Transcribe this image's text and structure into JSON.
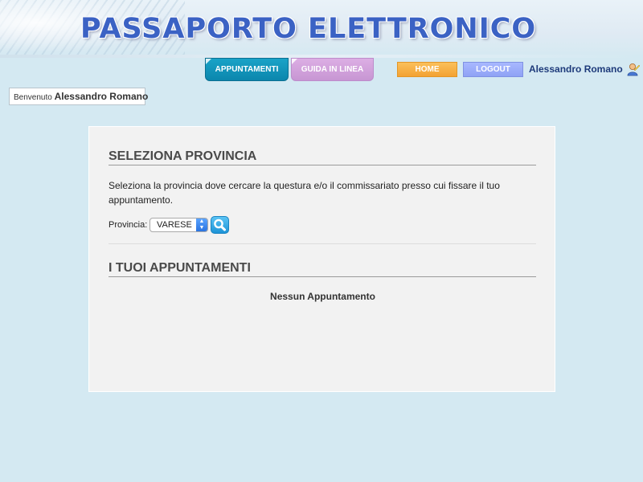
{
  "header": {
    "title": "PASSAPORTO ELETTRONICO",
    "user_name": "Alessandro Romano"
  },
  "nav": {
    "tabs": [
      {
        "label": "APPUNTAMENTI",
        "active": true
      },
      {
        "label": "GUIDA IN LINEA",
        "active": false
      }
    ],
    "home_label": "HOME",
    "logout_label": "LOGOUT"
  },
  "welcome": {
    "prefix": "Benvenuto",
    "name": "Alessandro Romano"
  },
  "provincia_section": {
    "title": "SELEZIONA PROVINCIA",
    "description": "Seleziona la provincia dove cercare la questura e/o il commissariato presso cui fissare il tuo appuntamento.",
    "label": "Provincia:",
    "selected": "VARESE"
  },
  "appuntamenti_section": {
    "title": "I TUOI APPUNTAMENTI",
    "empty_message": "Nessun Appuntamento"
  },
  "colors": {
    "background": "#d4e9f2",
    "active_tab": "#0b86ad",
    "guide_tab": "#c796d3",
    "home_button": "#f3a233",
    "logout_button": "#8fa2f5",
    "title_blue": "#3b62c4"
  },
  "icons": [
    "user-icon",
    "search-icon",
    "select-arrows-icon"
  ]
}
